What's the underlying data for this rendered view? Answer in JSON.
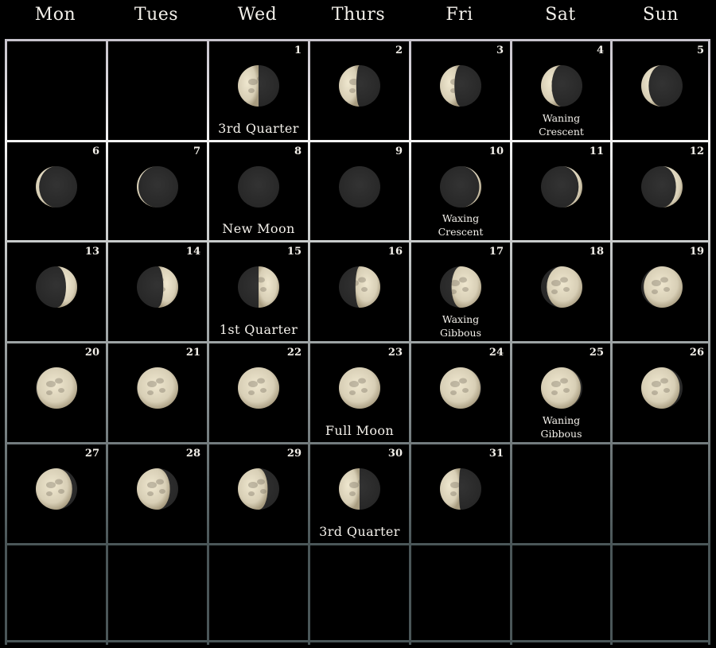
{
  "calendar": {
    "weekdays": [
      "Mon",
      "Tues",
      "Wed",
      "Thurs",
      "Fri",
      "Sat",
      "Sun"
    ],
    "colors": {
      "background": "#000000",
      "text": "#f3f0ea",
      "moon_lit": "#d8cfb6",
      "moon_dark": "#262626",
      "grid_top": "#c7c3cc",
      "grid_mid": "#f2f2f2",
      "grid_bottom": "#4a5658"
    },
    "first_weekday_index": 2,
    "days_in_month": 31,
    "days": [
      {
        "day": 1,
        "label": "1",
        "phase_label": "3rd Quarter",
        "illumination": 0.5,
        "waxing": false
      },
      {
        "day": 2,
        "label": "2",
        "phase_label": "",
        "illumination": 0.42,
        "waxing": false
      },
      {
        "day": 3,
        "label": "3",
        "phase_label": "",
        "illumination": 0.35,
        "waxing": false
      },
      {
        "day": 4,
        "label": "4",
        "phase_label": "Waning Crescent",
        "illumination": 0.26,
        "waxing": false
      },
      {
        "day": 5,
        "label": "5",
        "phase_label": "",
        "illumination": 0.18,
        "waxing": false
      },
      {
        "day": 6,
        "label": "6",
        "phase_label": "",
        "illumination": 0.08,
        "waxing": false
      },
      {
        "day": 7,
        "label": "7",
        "phase_label": "",
        "illumination": 0.04,
        "waxing": false
      },
      {
        "day": 8,
        "label": "8",
        "phase_label": "New Moon",
        "illumination": 0.0,
        "waxing": true
      },
      {
        "day": 9,
        "label": "9",
        "phase_label": "",
        "illumination": 0.0,
        "waxing": true
      },
      {
        "day": 10,
        "label": "10",
        "phase_label": "Waxing Crescent",
        "illumination": 0.05,
        "waxing": true
      },
      {
        "day": 11,
        "label": "11",
        "phase_label": "",
        "illumination": 0.09,
        "waxing": true
      },
      {
        "day": 12,
        "label": "12",
        "phase_label": "",
        "illumination": 0.16,
        "waxing": true
      },
      {
        "day": 13,
        "label": "13",
        "phase_label": "",
        "illumination": 0.27,
        "waxing": true
      },
      {
        "day": 14,
        "label": "14",
        "phase_label": "",
        "illumination": 0.36,
        "waxing": true
      },
      {
        "day": 15,
        "label": "15",
        "phase_label": "1st Quarter",
        "illumination": 0.5,
        "waxing": true
      },
      {
        "day": 16,
        "label": "16",
        "phase_label": "",
        "illumination": 0.6,
        "waxing": true
      },
      {
        "day": 17,
        "label": "17",
        "phase_label": "Waxing Gibbous",
        "illumination": 0.72,
        "waxing": true
      },
      {
        "day": 18,
        "label": "18",
        "phase_label": "",
        "illumination": 0.86,
        "waxing": true
      },
      {
        "day": 19,
        "label": "19",
        "phase_label": "",
        "illumination": 0.94,
        "waxing": true
      },
      {
        "day": 20,
        "label": "20",
        "phase_label": "",
        "illumination": 0.98,
        "waxing": true
      },
      {
        "day": 21,
        "label": "21",
        "phase_label": "",
        "illumination": 0.99,
        "waxing": true
      },
      {
        "day": 22,
        "label": "22",
        "phase_label": "",
        "illumination": 1.0,
        "waxing": true
      },
      {
        "day": 23,
        "label": "23",
        "phase_label": "Full Moon",
        "illumination": 1.0,
        "waxing": false
      },
      {
        "day": 24,
        "label": "24",
        "phase_label": "",
        "illumination": 0.98,
        "waxing": false
      },
      {
        "day": 25,
        "label": "25",
        "phase_label": "Waning Gibbous",
        "illumination": 0.96,
        "waxing": false
      },
      {
        "day": 26,
        "label": "26",
        "phase_label": "",
        "illumination": 0.93,
        "waxing": false
      },
      {
        "day": 27,
        "label": "27",
        "phase_label": "",
        "illumination": 0.88,
        "waxing": false
      },
      {
        "day": 28,
        "label": "28",
        "phase_label": "",
        "illumination": 0.8,
        "waxing": false
      },
      {
        "day": 29,
        "label": "29",
        "phase_label": "",
        "illumination": 0.72,
        "waxing": false
      },
      {
        "day": 30,
        "label": "30",
        "phase_label": "3rd Quarter",
        "illumination": 0.5,
        "waxing": false
      },
      {
        "day": 31,
        "label": "31",
        "phase_label": "",
        "illumination": 0.46,
        "waxing": false
      }
    ]
  }
}
